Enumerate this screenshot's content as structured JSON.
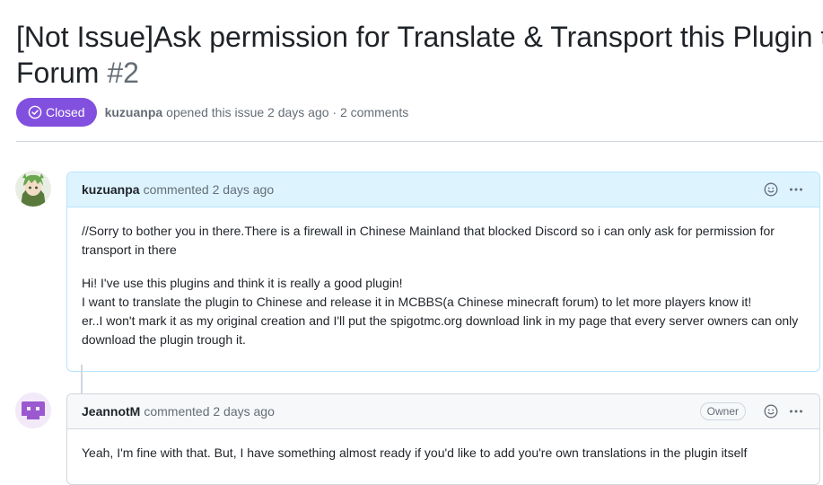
{
  "issue": {
    "title_line1": "[Not Issue]Ask permission for Translate & Transport this Plugin to",
    "title_line2": "Forum",
    "number": "#2",
    "state": "Closed",
    "author": "kuzuanpa",
    "meta_text": "opened this issue 2 days ago · 2 comments"
  },
  "comments": [
    {
      "author": "kuzuanpa",
      "action": "commented 2 days ago",
      "avatar_icon": "anime-avatar",
      "body_p1": "//Sorry to bother you in there.There is a firewall in Chinese Mainland that blocked Discord so i can only ask for permission for transport in there",
      "body_p2_line1": "Hi! I've use this plugins and think it is really a good plugin!",
      "body_p2_line2": "I want to translate the plugin to Chinese and release it in MCBBS(a Chinese minecraft forum) to let more players know it!",
      "body_p2_line3": "er..I won't mark it as my original creation and I'll put the spigotmc.org download link in my page that every server owners can only download the plugin trough it."
    },
    {
      "author": "JeannotM",
      "action": "commented 2 days ago",
      "badge": "Owner",
      "avatar_icon": "identicon-avatar",
      "body_p1": "Yeah, I'm fine with that. But, I have something almost ready if you'd like to add you're own translations in the plugin itself"
    }
  ],
  "colors": {
    "closed_badge": "#8250df",
    "author_header_bg": "#ddf4ff",
    "author_header_border": "#b6e3ff",
    "identicon": "#9b59d0"
  }
}
